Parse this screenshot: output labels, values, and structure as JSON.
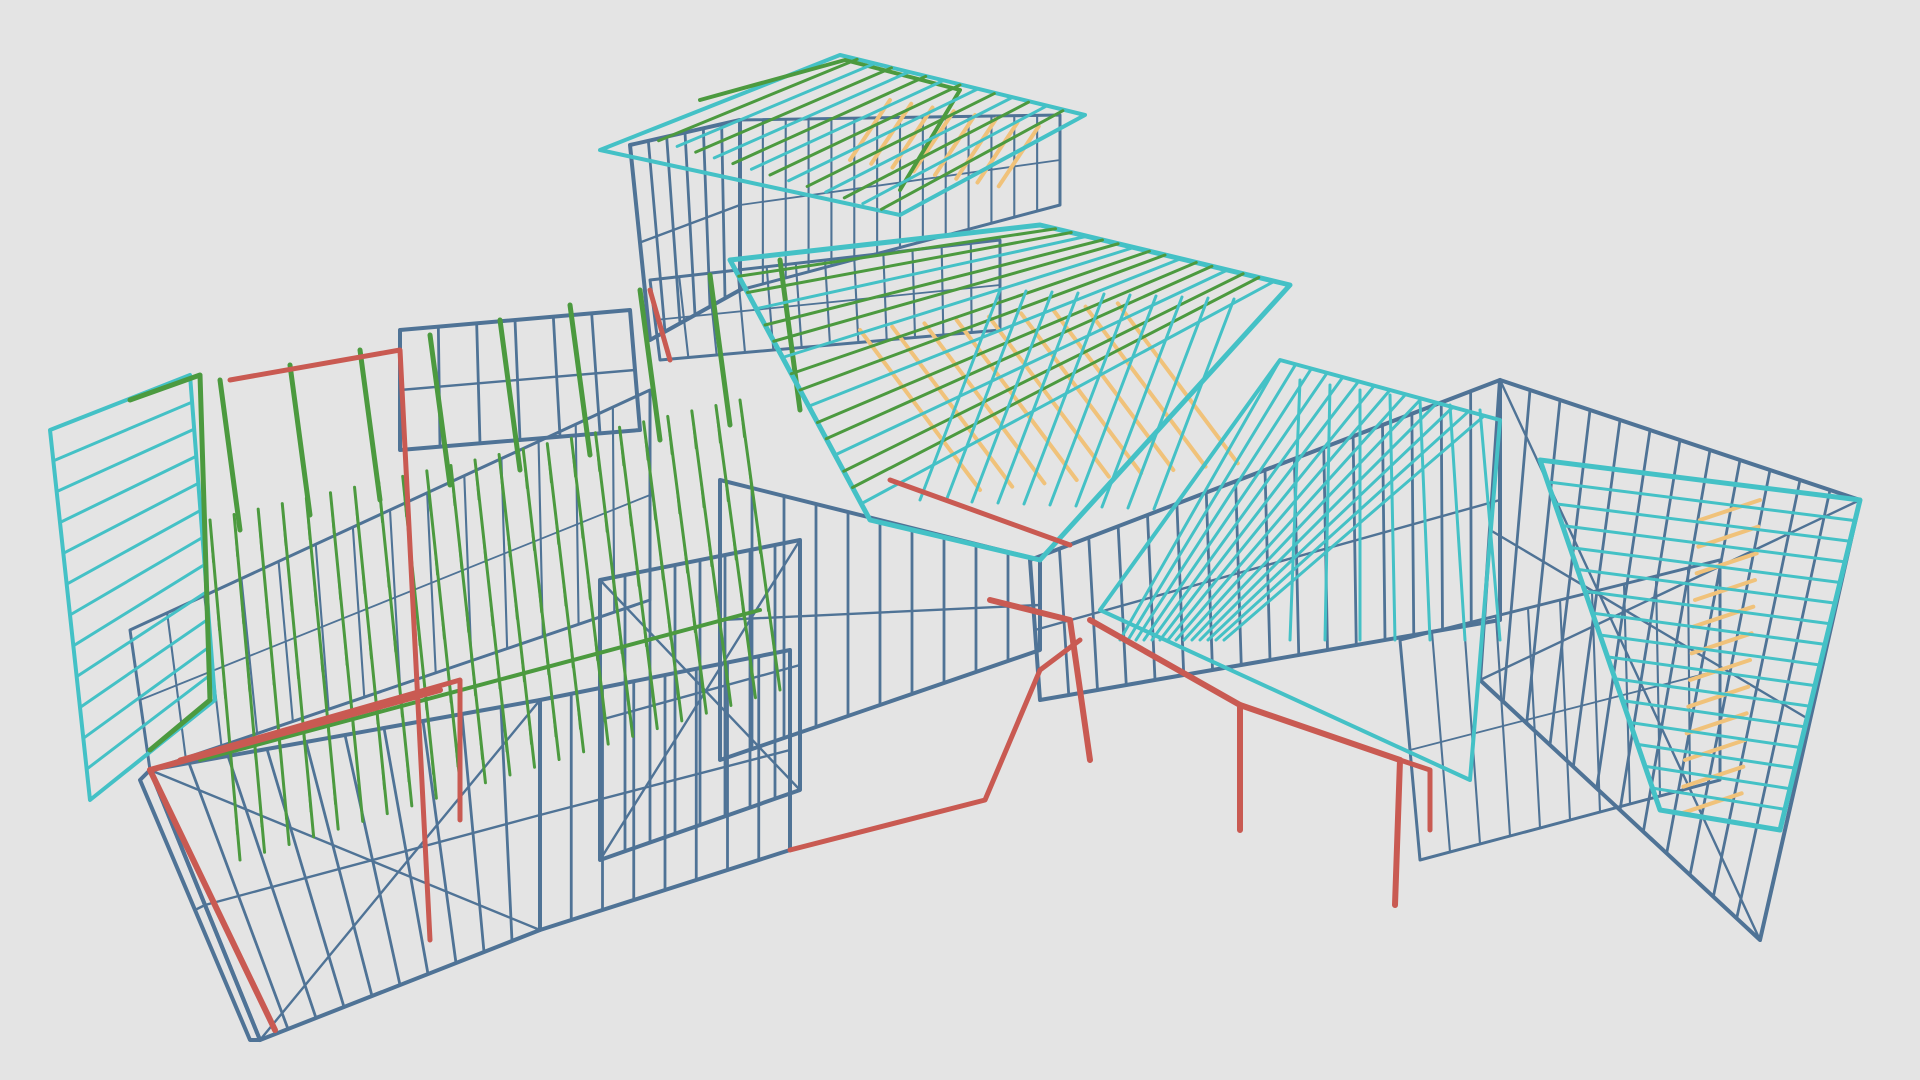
{
  "scene": {
    "kind": "3d-structural-frame-model",
    "background_color": "#e4e4e4",
    "members": [
      {
        "type": "wall-frames",
        "color": "#4f7396"
      },
      {
        "type": "floor-joists",
        "color": "#4c9a3f"
      },
      {
        "type": "roof-trusses",
        "color": "#44c1c6"
      },
      {
        "type": "roof-battens",
        "color": "#f0c27a"
      },
      {
        "type": "steel-beams",
        "color": "#c95a52"
      }
    ]
  }
}
